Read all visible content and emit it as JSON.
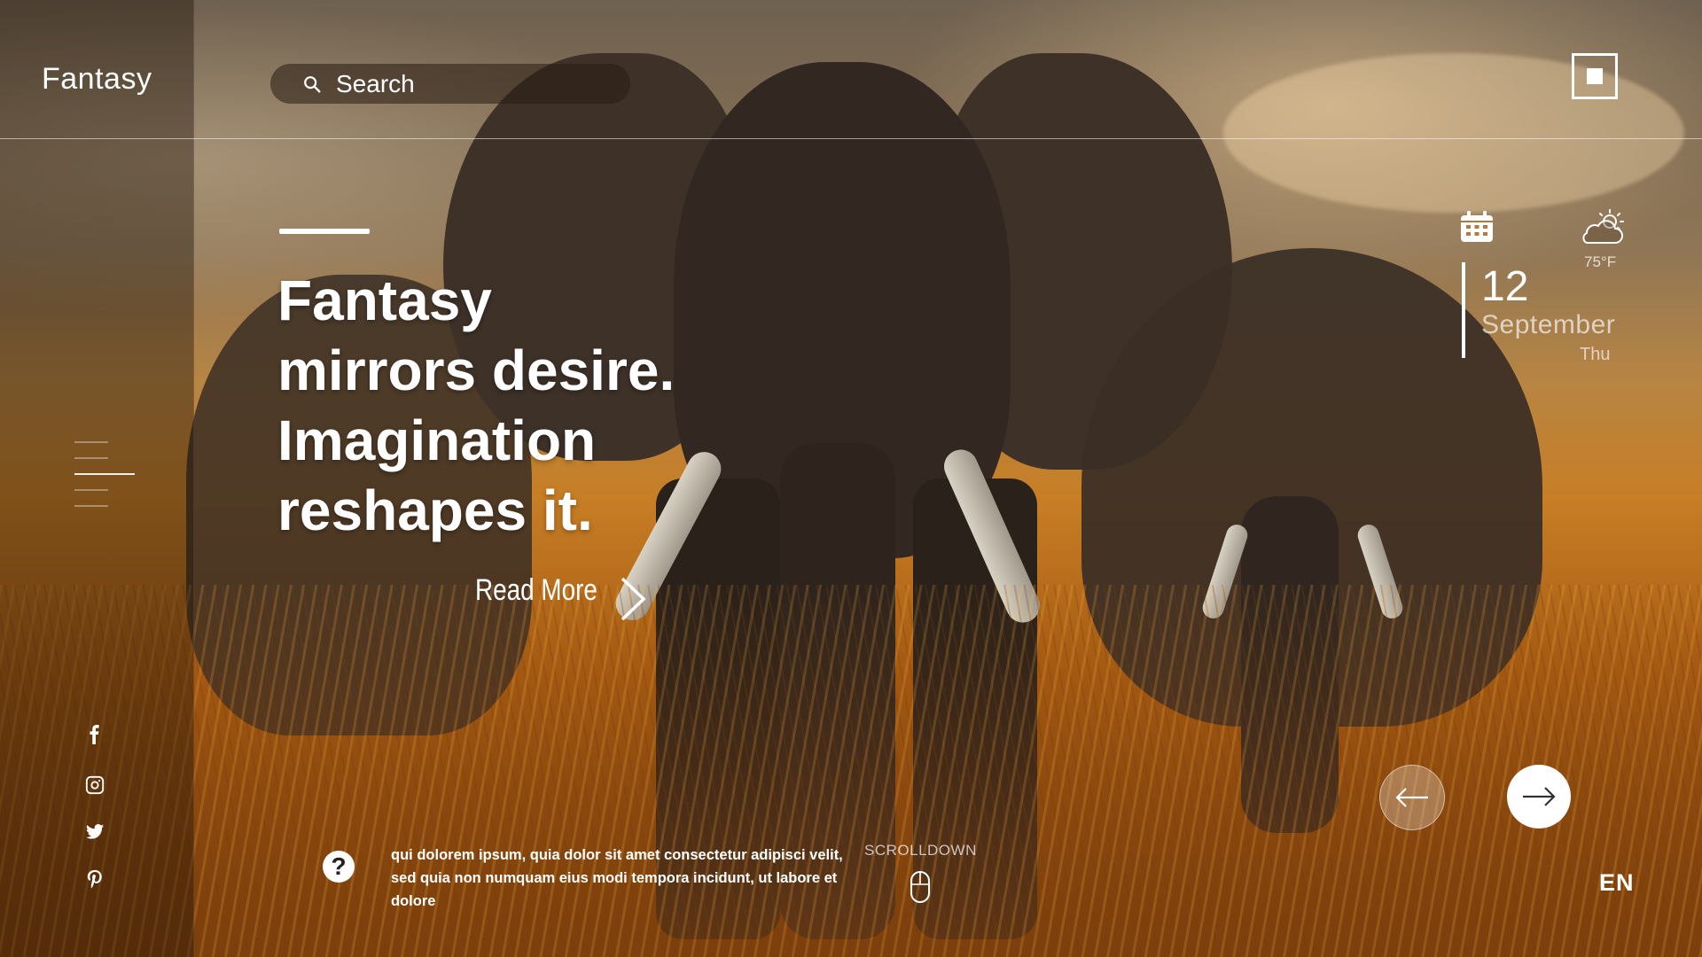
{
  "app": {
    "brand": "Fantasy"
  },
  "search": {
    "placeholder": "Search"
  },
  "hero": {
    "headline_lines": [
      "Fantasy",
      "mirrors desire.",
      "Imagination",
      "reshapes it."
    ],
    "read_more": "Read More"
  },
  "widget": {
    "temperature": "75°F",
    "day": "12",
    "month": "September",
    "weekday": "Thu"
  },
  "footer": {
    "help_symbol": "?",
    "description": "qui dolorem ipsum, quia dolor sit amet consectetur adipisci velit, sed quia non numquam eius modi tempora incidunt, ut labore et dolore",
    "scroll_label": "SCROLLDOWN",
    "language": "EN"
  },
  "social": [
    "facebook-icon",
    "instagram-icon",
    "twitter-icon",
    "pinterest-icon"
  ],
  "menu": {
    "item_count": 5,
    "active_index": 2
  },
  "colors": {
    "accent": "#ffffff",
    "overlay": "#1e140a",
    "warm": "#c77e25"
  }
}
